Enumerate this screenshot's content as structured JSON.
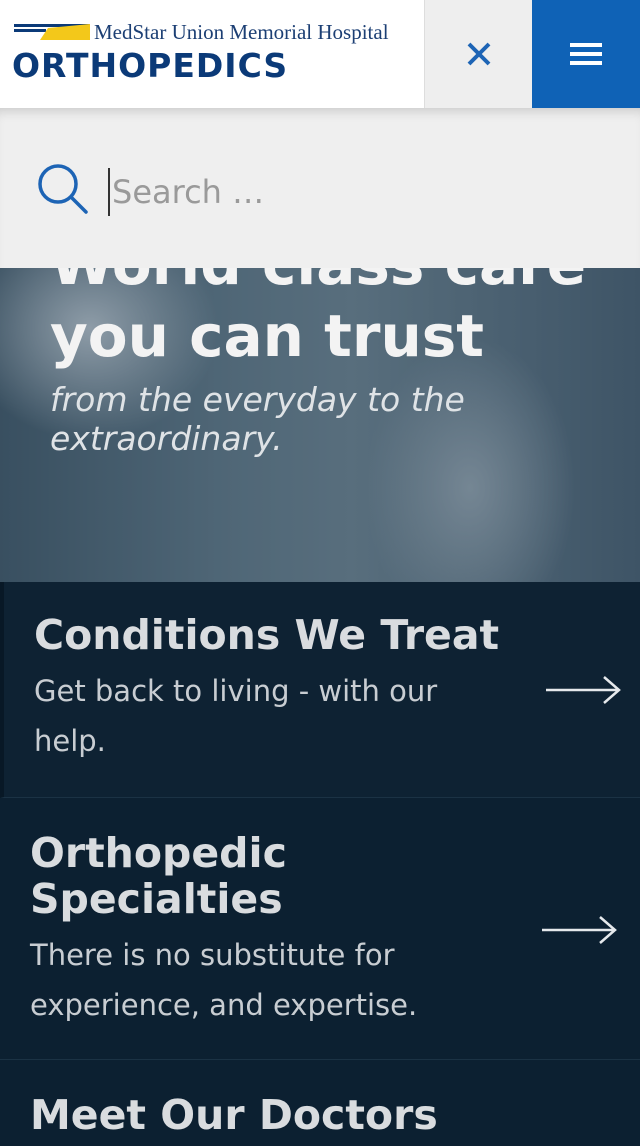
{
  "header": {
    "hospital_name": "MedStar Union Memorial Hospital",
    "brand": "ORTHOPEDICS",
    "close_icon": "close-icon",
    "menu_icon": "hamburger-menu-icon",
    "colors": {
      "brand_blue": "#0b3a78",
      "menu_button": "#0f62b6",
      "logo_yellow": "#f3c81a"
    }
  },
  "search": {
    "placeholder": "Search …",
    "icon": "search-icon"
  },
  "hero": {
    "title": "World class care you can trust",
    "subtitle": "from the everyday to the extraordinary."
  },
  "cards": [
    {
      "title": "Conditions We Treat",
      "description": "Get back to living - with our help.",
      "icon": "arrow-right-icon"
    },
    {
      "title": "Orthopedic Specialties",
      "description": "There is no substitute for experience, and expertise.",
      "icon": "arrow-right-icon"
    },
    {
      "title": "Meet Our Doctors"
    }
  ]
}
